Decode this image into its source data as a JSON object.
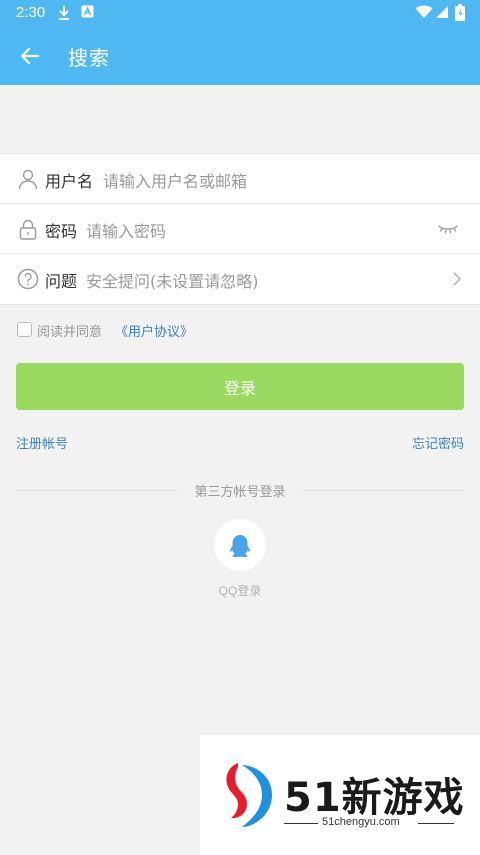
{
  "status_bar": {
    "time": "2:30"
  },
  "toolbar": {
    "title": "搜索"
  },
  "form": {
    "username": {
      "label": "用户名",
      "placeholder": "请输入用户名或邮箱"
    },
    "password": {
      "label": "密码",
      "placeholder": "请输入密码"
    },
    "question": {
      "label": "问题",
      "placeholder": "安全提问(未设置请忽略)"
    }
  },
  "agreement": {
    "text": "阅读并同意",
    "link": "《用户协议》",
    "checked": false
  },
  "login_button": "登录",
  "register_link": "注册帐号",
  "forgot_link": "忘记密码",
  "third_party": {
    "heading": "第三方帐号登录",
    "qq_label": "QQ登录"
  },
  "watermark": {
    "brand": "51新游戏",
    "site": "51chengyu.com"
  },
  "colors": {
    "primary": "#4fb7f2",
    "button": "#99d95f",
    "link": "#3d82c4",
    "qq": "#4aa3e6"
  }
}
